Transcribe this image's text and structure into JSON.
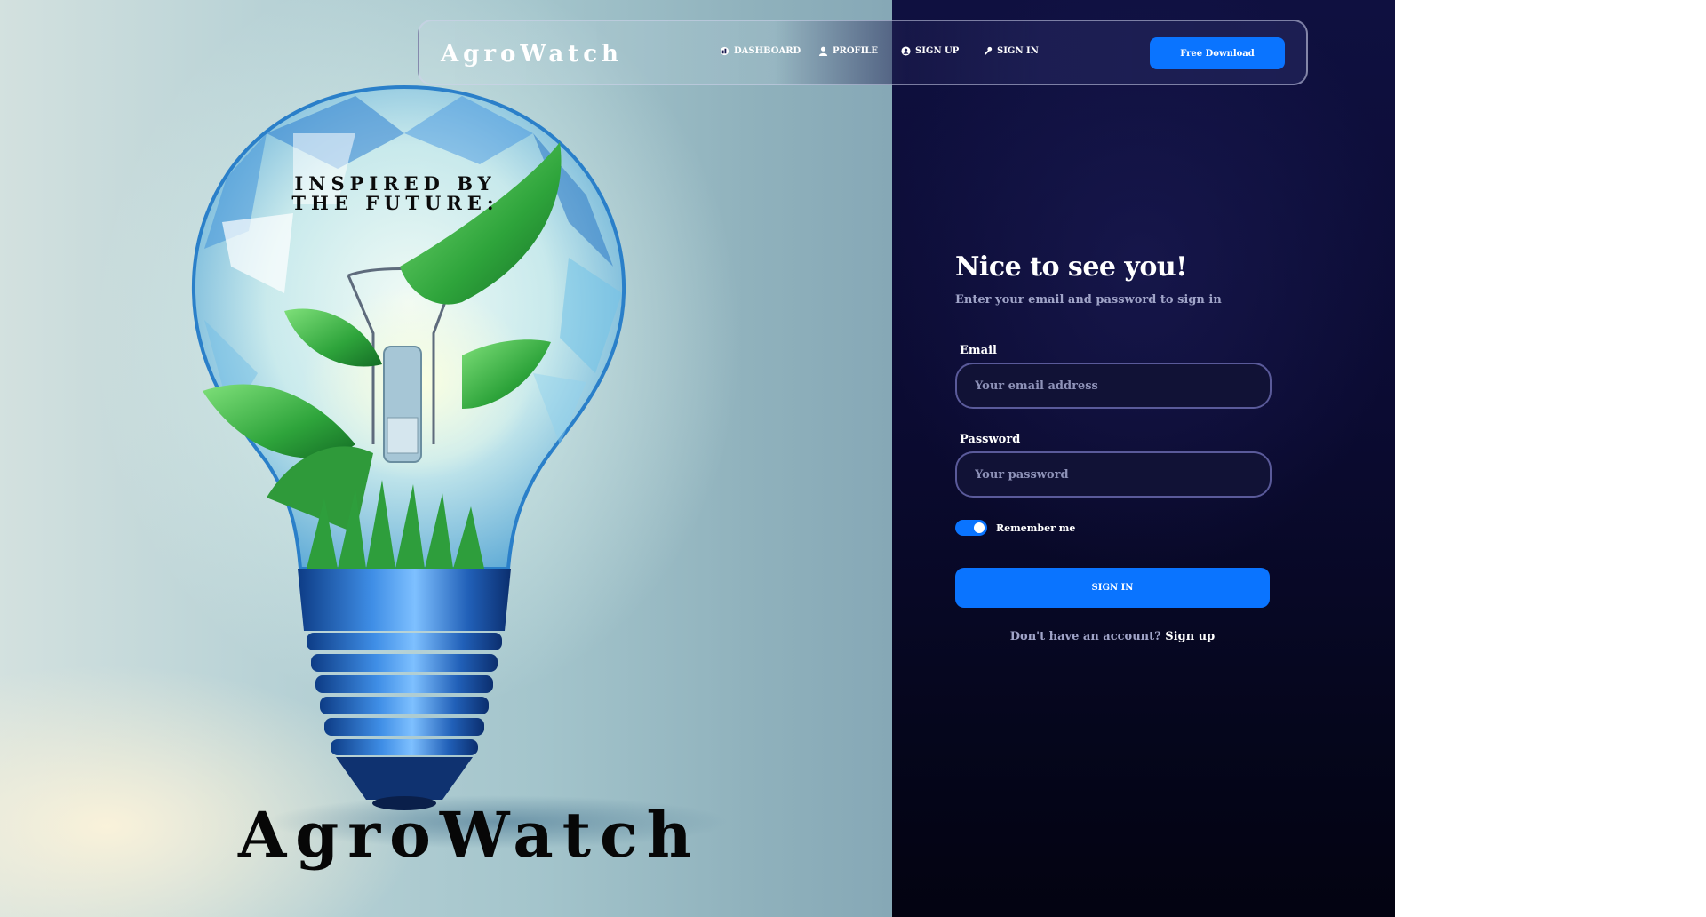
{
  "brand": {
    "nav_logo": "AgroWatch",
    "hero_tagline": "INSPIRED BY THE FUTURE:",
    "hero_title": "AgroWatch"
  },
  "navbar": {
    "links": [
      {
        "label": "DASHBOARD",
        "icon": "dashboard-icon"
      },
      {
        "label": "PROFILE",
        "icon": "user-icon"
      },
      {
        "label": "SIGN UP",
        "icon": "account-circle-icon"
      },
      {
        "label": "SIGN IN",
        "icon": "key-icon"
      }
    ],
    "cta_label": "Free Download"
  },
  "form": {
    "title": "Nice to see you!",
    "subtitle": "Enter your email and password to sign in",
    "email_label": "Email",
    "email_placeholder": "Your email address",
    "email_value": "",
    "password_label": "Password",
    "password_placeholder": "Your password",
    "password_value": "",
    "remember_label": "Remember me",
    "remember_checked": true,
    "submit_label": "SIGN IN",
    "signup_prompt": "Don't have an account?",
    "signup_link": "Sign up"
  },
  "colors": {
    "accent": "#0a74ff",
    "panel_dark": "#0b0b32",
    "muted_text": "#a0a4c8"
  }
}
